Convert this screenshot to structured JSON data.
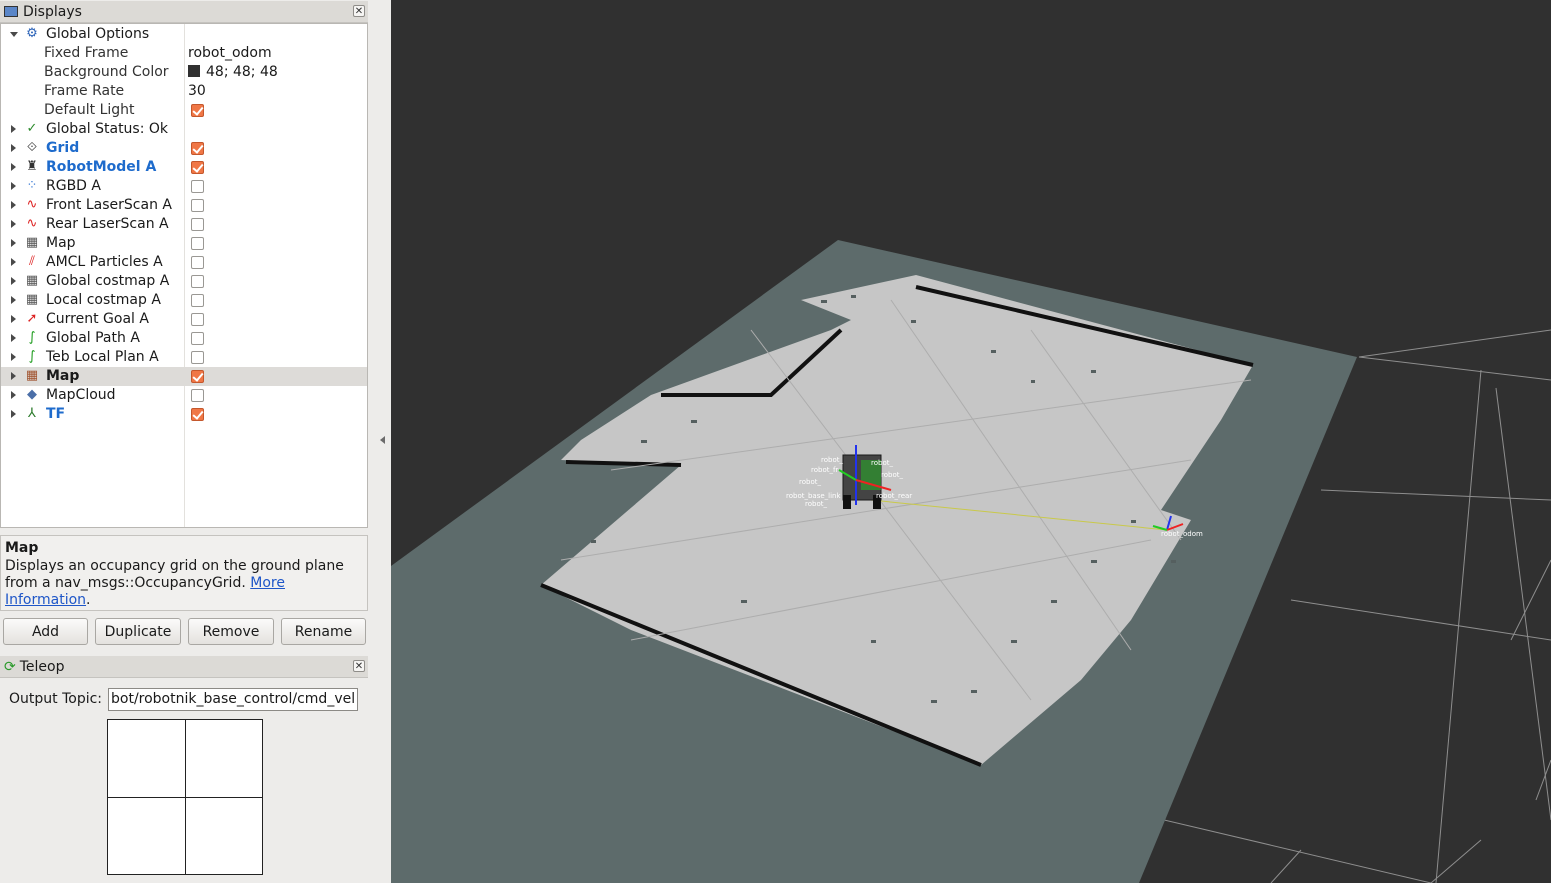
{
  "displays_panel": {
    "title": "Displays",
    "close_glyph": "✕",
    "global_options": {
      "label": "Global Options",
      "icon": "gear-icon",
      "fixed_frame_label": "Fixed Frame",
      "fixed_frame_value": "robot_odom",
      "background_color_label": "Background Color",
      "background_color_value": "48; 48; 48",
      "background_color_hex": "#303030",
      "frame_rate_label": "Frame Rate",
      "frame_rate_value": "30",
      "default_light_label": "Default Light",
      "default_light_checked": true
    },
    "items": [
      {
        "label": "Global Status: Ok",
        "icon": "check-icon",
        "checked": null
      },
      {
        "label": "Grid",
        "icon": "grid-icon",
        "checked": true
      },
      {
        "label": "RobotModel A",
        "icon": "robot-icon",
        "checked": true
      },
      {
        "label": "RGBD A",
        "icon": "pointcloud-icon",
        "checked": false
      },
      {
        "label": "Front LaserScan A",
        "icon": "laserscan-icon",
        "checked": false
      },
      {
        "label": "Rear LaserScan A",
        "icon": "laserscan-icon",
        "checked": false
      },
      {
        "label": "Map",
        "icon": "map-icon",
        "checked": false
      },
      {
        "label": "AMCL Particles A",
        "icon": "particles-icon",
        "checked": false
      },
      {
        "label": "Global costmap A",
        "icon": "map-icon",
        "checked": false
      },
      {
        "label": "Local costmap A",
        "icon": "map-icon",
        "checked": false
      },
      {
        "label": "Current Goal A",
        "icon": "goal-icon",
        "checked": false
      },
      {
        "label": "Global Path A",
        "icon": "path-icon",
        "checked": false
      },
      {
        "label": "Teb Local Plan A",
        "icon": "path-icon",
        "checked": false
      },
      {
        "label": "Map",
        "icon": "map-icon",
        "checked": true
      },
      {
        "label": "MapCloud",
        "icon": "diamond-icon",
        "checked": false
      },
      {
        "label": "TF",
        "icon": "tf-axes-icon",
        "checked": true
      }
    ]
  },
  "description": {
    "title": "Map",
    "text": "Displays an occupancy grid on the ground plane from a nav_msgs::OccupancyGrid.",
    "link": "More Information",
    "trailing": "."
  },
  "buttons": {
    "add": "Add",
    "duplicate": "Duplicate",
    "remove": "Remove",
    "rename": "Rename"
  },
  "teleop": {
    "title": "Teleop",
    "output_topic_label": "Output Topic:",
    "output_topic_value": "bot/robotnik_base_control/cmd_vel"
  },
  "viewport": {
    "background": "#303030",
    "map_free_color": "#c6c6c6",
    "map_unknown_color": "#5d6b6b",
    "grid_color": "#a0a0a0"
  }
}
